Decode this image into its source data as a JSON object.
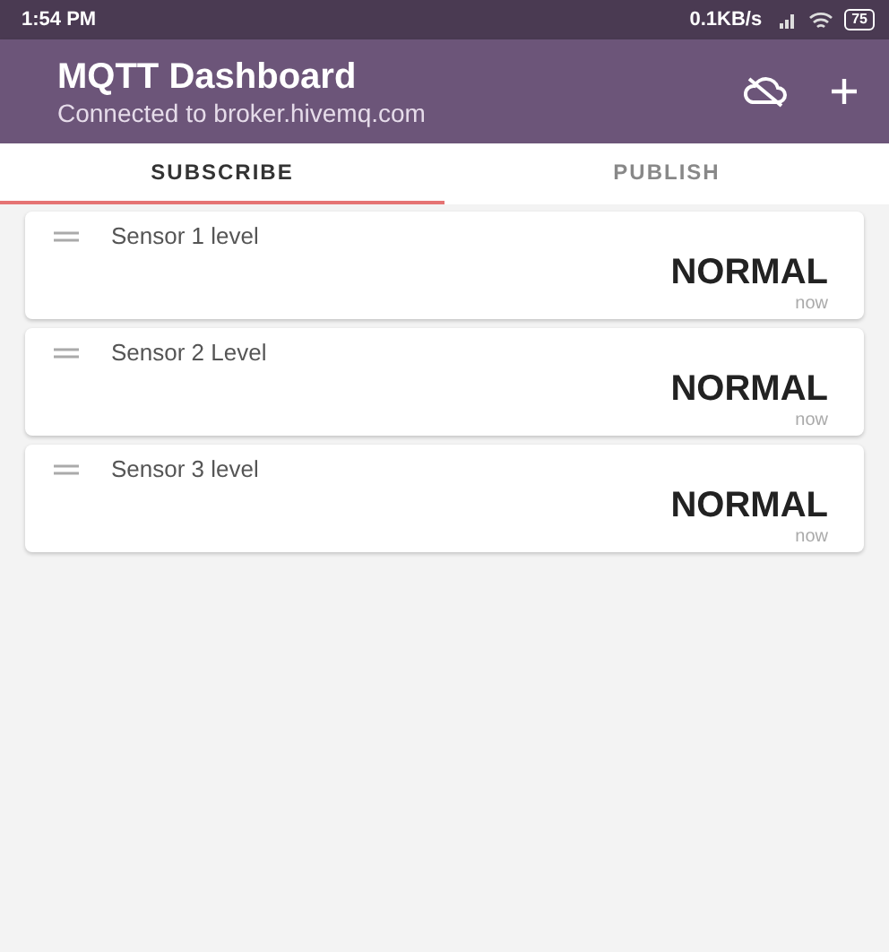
{
  "status_bar": {
    "time": "1:54 PM",
    "speed": "0.1KB/s",
    "battery": "75"
  },
  "app_bar": {
    "title": "MQTT Dashboard",
    "subtitle": "Connected to broker.hivemq.com"
  },
  "tabs": [
    {
      "label": "SUBSCRIBE",
      "selected": true
    },
    {
      "label": "PUBLISH",
      "selected": false
    }
  ],
  "tiles": [
    {
      "name": "Sensor 1 level",
      "value": "NORMAL",
      "time": "now"
    },
    {
      "name": "Sensor 2 Level",
      "value": "NORMAL",
      "time": "now"
    },
    {
      "name": "Sensor 3 level",
      "value": "NORMAL",
      "time": "now"
    }
  ]
}
